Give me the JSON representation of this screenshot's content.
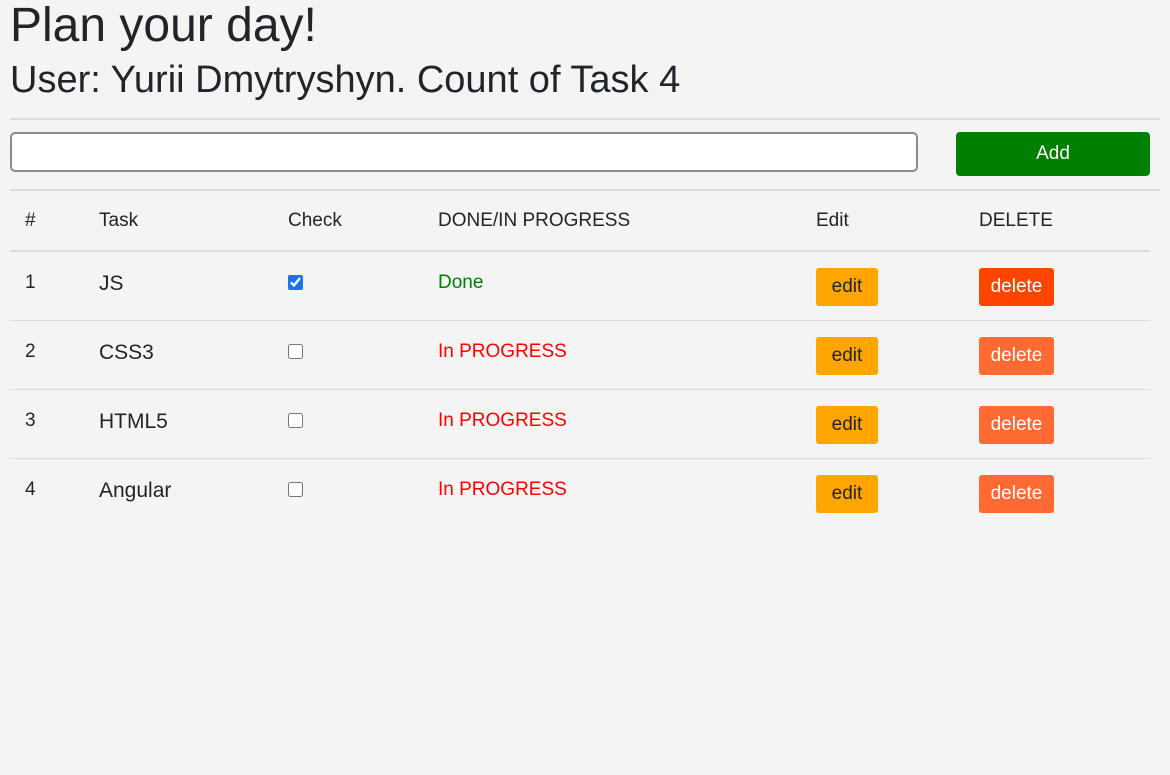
{
  "header": {
    "title": "Plan your day!",
    "user_prefix": "User: ",
    "user_name": "Yurii Dmytryshyn",
    "count_label": ". Count of Task ",
    "count": "4"
  },
  "add_form": {
    "input_value": "",
    "button_label": "Add"
  },
  "table": {
    "headers": [
      "#",
      "Task",
      "Check",
      "DONE/IN PROGRESS",
      "Edit",
      "DELETE"
    ],
    "rows": [
      {
        "num": "1",
        "task": "JS",
        "checked": true,
        "status": "Done",
        "edit_label": "edit",
        "delete_label": "delete"
      },
      {
        "num": "2",
        "task": "CSS3",
        "checked": false,
        "status": "In PROGRESS",
        "edit_label": "edit",
        "delete_label": "delete"
      },
      {
        "num": "3",
        "task": "HTML5",
        "checked": false,
        "status": "In PROGRESS",
        "edit_label": "edit",
        "delete_label": "delete"
      },
      {
        "num": "4",
        "task": "Angular",
        "checked": false,
        "status": "In PROGRESS",
        "edit_label": "edit",
        "delete_label": "delete"
      }
    ]
  },
  "colors": {
    "add_button": "#008000",
    "done_text": "#008000",
    "progress_text": "#ff0000",
    "edit_button": "#ffa500",
    "delete_button_active": "#ff4500",
    "delete_button": "#ff6a33"
  }
}
